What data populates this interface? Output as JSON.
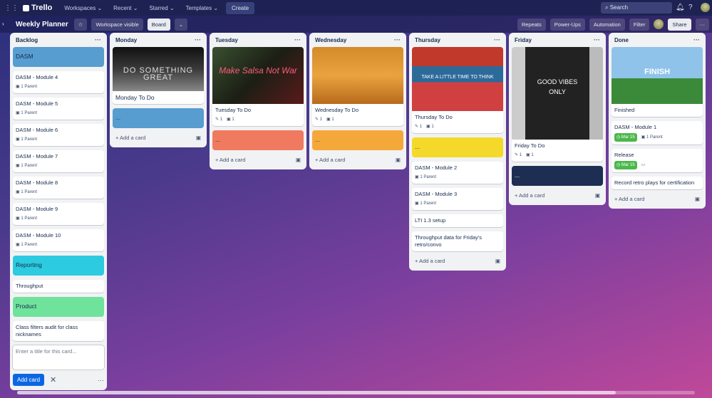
{
  "header": {
    "app": "Trello",
    "menus": [
      "Workspaces",
      "Recent",
      "Starred",
      "Templates"
    ],
    "create": "Create",
    "search_placeholder": "Search"
  },
  "board": {
    "title": "Weekly Planner",
    "visibility": "Workspace visible",
    "view": "Board",
    "repeats": "Repeats",
    "powerups": "Power-Ups",
    "automation": "Automation",
    "filter": "Filter",
    "share": "Share"
  },
  "lists": {
    "backlog": {
      "title": "Backlog",
      "cards": [
        "DASM - Module 4",
        "DASM - Module 5",
        "DASM - Module 6",
        "DASM - Module 7",
        "DASM - Module 8",
        "DASM - Module 9",
        "DASM - Module 10"
      ],
      "badge": "1 Parent",
      "labels": {
        "dasm": "DASM",
        "reporting": "Reporting",
        "product": "Product"
      },
      "throughput": "Throughput",
      "class_filters": "Class filters audit for class nicknames",
      "composer_placeholder": "Enter a title for this card...",
      "add_card": "Add card"
    },
    "monday": {
      "title": "Monday",
      "cover_text": "DO SOMETHING GREAT",
      "card": "Monday To Do",
      "dots": "..."
    },
    "tuesday": {
      "title": "Tuesday",
      "cover_text": "Make Salsa Not War",
      "card": "Tuesday To Do",
      "dots": "..."
    },
    "wednesday": {
      "title": "Wednesday",
      "card": "Wednesday To Do",
      "dots": "..."
    },
    "thursday": {
      "title": "Thursday",
      "cover_text": "TAKE A LITTLE TIME TO THINK",
      "card": "Thursday To Do",
      "dots": "...",
      "m2": "DASM - Module 2",
      "m3": "DASM - Module 3",
      "lti": "LTI 1.3 setup",
      "throughput": "Throughput data for Friday's retro/convo"
    },
    "friday": {
      "title": "Friday",
      "cover_text": "GOOD VIBES ONLY",
      "card": "Friday To Do",
      "dots": "..."
    },
    "done": {
      "title": "Done",
      "cover_text": "FINISH",
      "finished": "Finished",
      "m1": "DASM - Module 1",
      "due": "Mar 15",
      "release": "Release",
      "retro": "Record retro plays for certification"
    }
  },
  "common": {
    "add_a_card": "+ Add a card",
    "one": "1",
    "list_menu": "···"
  }
}
